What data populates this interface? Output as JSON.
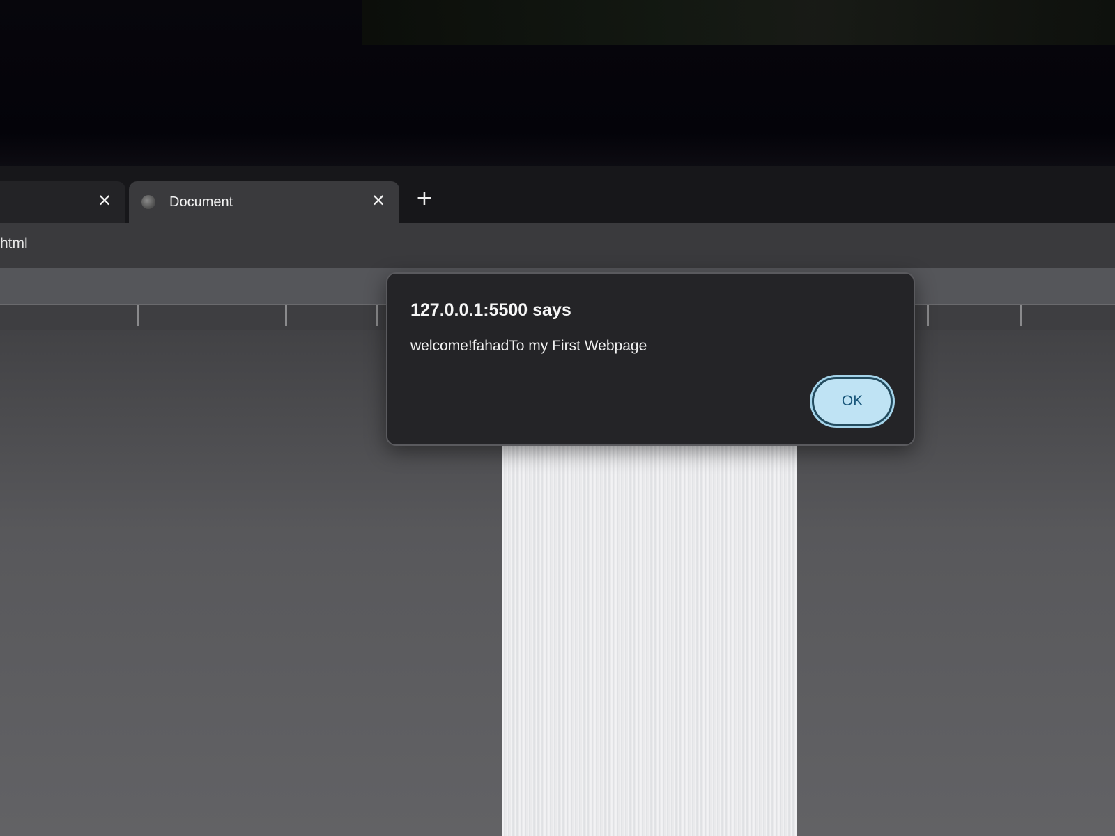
{
  "tabs": [
    {
      "title": "",
      "close_label": "✕"
    },
    {
      "title": "Document",
      "close_label": "✕"
    }
  ],
  "new_tab_label": "+",
  "address_bar": {
    "url_fragment": "html"
  },
  "alert": {
    "title": "127.0.0.1:5500 says",
    "message": "welcome!fahadTo my First Webpage",
    "ok_label": "OK"
  },
  "colors": {
    "dialog_background": "#242427",
    "ok_button_fill": "#bfe3f4",
    "ok_button_text": "#18567a",
    "tab_active": "#3a3a3d"
  },
  "icons": {
    "tab_favicon": "globe-icon",
    "tab_close": "close-icon",
    "new_tab": "plus-icon"
  }
}
